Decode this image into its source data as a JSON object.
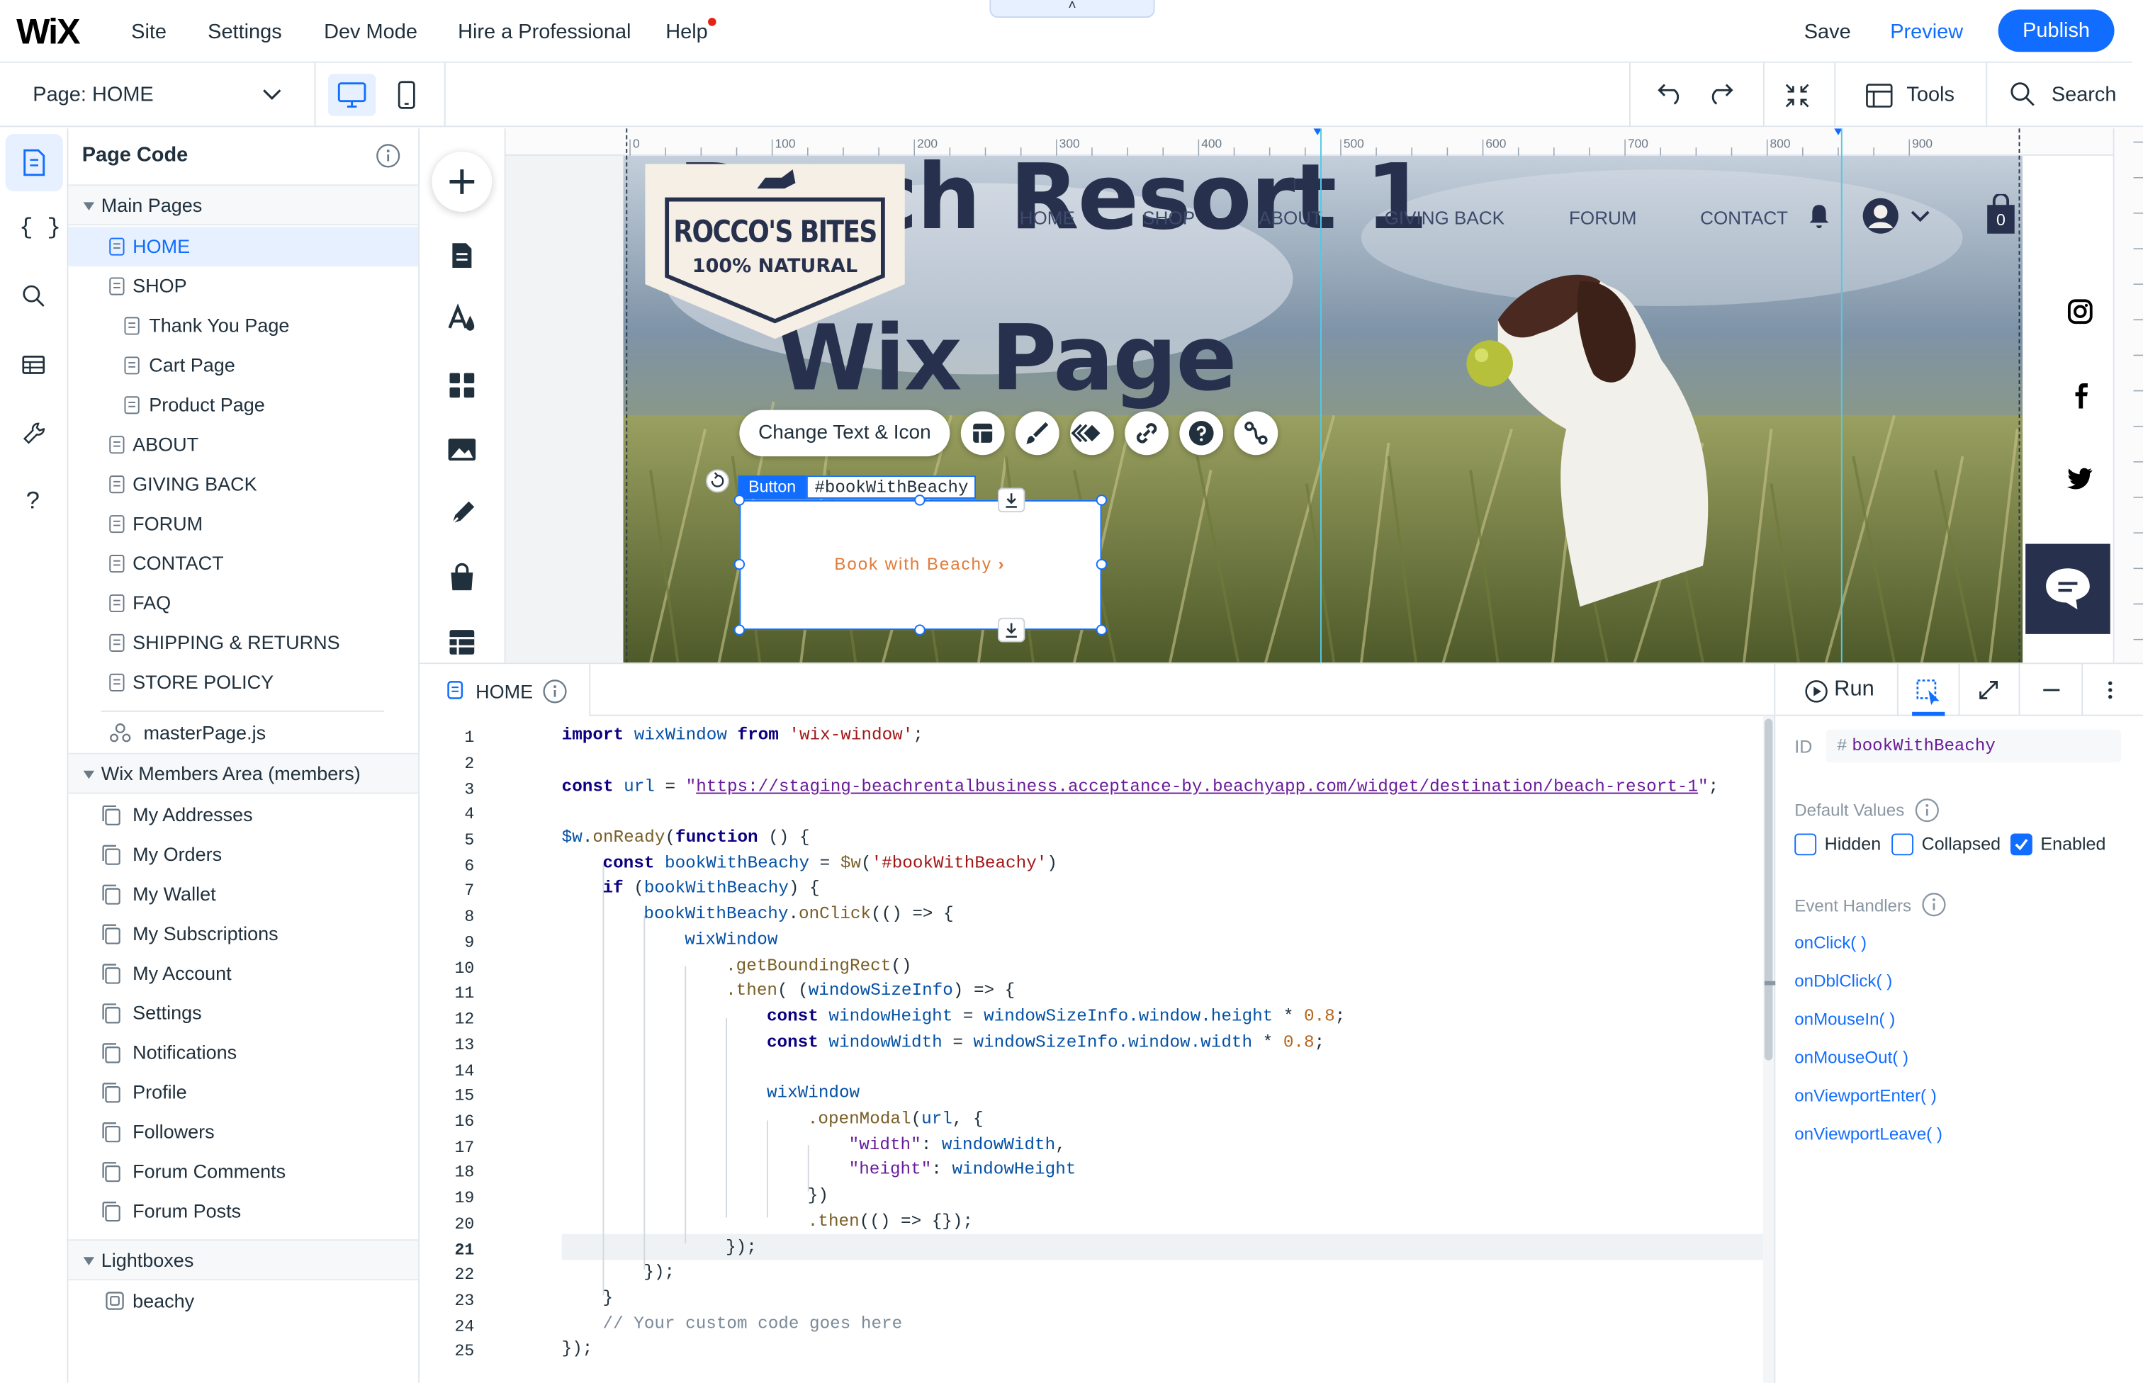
{
  "topbar": {
    "logo": "WiX",
    "menu": [
      "Site",
      "Settings",
      "Dev Mode",
      "Hire a Professional",
      "Help"
    ],
    "save": "Save",
    "preview": "Preview",
    "publish": "Publish",
    "collapse": "˄"
  },
  "toolbar": {
    "page_label": "Page:",
    "page_name": "HOME",
    "tools": "Tools",
    "search": "Search"
  },
  "panel": {
    "title": "Page Code",
    "main_pages_header": "Main Pages",
    "main_pages": [
      "HOME",
      "SHOP",
      "Thank You Page",
      "Cart Page",
      "Product Page",
      "ABOUT",
      "GIVING BACK",
      "FORUM",
      "CONTACT",
      "FAQ",
      "SHIPPING & RETURNS",
      "STORE POLICY"
    ],
    "master_page": "masterPage.js",
    "members_header": "Wix Members Area (members)",
    "members_pages": [
      "My Addresses",
      "My Orders",
      "My Wallet",
      "My Subscriptions",
      "My Account",
      "Settings",
      "Notifications",
      "Profile",
      "Followers",
      "Forum Comments",
      "Forum Posts"
    ],
    "lightboxes_header": "Lightboxes",
    "lightboxes": [
      "beachy"
    ]
  },
  "canvas": {
    "ruler_ticks": [
      "0",
      "100",
      "200",
      "300",
      "400",
      "500",
      "600",
      "700",
      "800",
      "900"
    ],
    "heading_line1": "Beach Resort 1",
    "heading_line2": "Wix Page",
    "logo_line1": "ROCCO'S BITES",
    "logo_line2": "100% NATURAL",
    "nav": [
      "HOME",
      "SHOP",
      "ABOUT",
      "GIVING BACK",
      "FORUM",
      "CONTACT"
    ],
    "cart_count": "0",
    "change_text_icon": "Change Text & Icon",
    "element_type": "Button",
    "element_id": "#bookWithBeachy",
    "button_label": "Book with Beachy"
  },
  "code_editor": {
    "tab": "HOME",
    "run": "Run",
    "current_line": 21,
    "line_numbers": [
      "1",
      "2",
      "3",
      "4",
      "5",
      "6",
      "7",
      "8",
      "9",
      "10",
      "11",
      "12",
      "13",
      "14",
      "15",
      "16",
      "17",
      "18",
      "19",
      "20",
      "21",
      "22",
      "23",
      "24",
      "25"
    ],
    "url": "https://staging-beachrentalbusiness.acceptance-by.beachyapp.com/widget/destination/beach-resort-1",
    "lines": {
      "l1_kw": "import",
      "l1_id": "wixWindow",
      "l1_from": "from",
      "l1_str": "'wix-window'",
      "l1_end": ";",
      "l3_kw": "const",
      "l3_id": "url",
      "l3_eq": " = ",
      "l3_q1": "\"",
      "l3_q2": "\"",
      "l3_end": ";",
      "l5_a": "$w",
      "l5_b": ".",
      "l5_c": "onReady",
      "l5_d": "(",
      "l5_e": "function",
      "l5_f": " () {",
      "l6_kw": "const",
      "l6_id": "bookWithBeachy",
      "l6_eq": " = ",
      "l6_fn": "$w",
      "l6_p": "(",
      "l6_str": "'#bookWithBeachy'",
      "l6_end": ")",
      "l7_kw": "if",
      "l7_a": " (",
      "l7_id": "bookWithBeachy",
      "l7_b": ") {",
      "l8_id": "bookWithBeachy",
      "l8_dot": ".",
      "l8_fn": "onClick",
      "l8_rest": "(() => {",
      "l9_id": "wixWindow",
      "l10_fn": ".getBoundingRect",
      "l10_rest": "()",
      "l11_fn": ".then",
      "l11_a": "( (",
      "l11_id": "windowSizeInfo",
      "l11_b": ") => {",
      "l12_kw": "const",
      "l12_id": "windowHeight",
      "l12_eq": " = ",
      "l12_ref": "windowSizeInfo.window.height",
      "l12_op": " * ",
      "l12_num": "0.8",
      "l12_end": ";",
      "l13_kw": "const",
      "l13_id": "windowWidth",
      "l13_eq": " = ",
      "l13_ref": "windowSizeInfo.window.width",
      "l13_op": " * ",
      "l13_num": "0.8",
      "l13_end": ";",
      "l15_id": "wixWindow",
      "l16_fn": ".openModal",
      "l16_a": "(",
      "l16_id": "url",
      "l16_b": ", {",
      "l17_k": "\"width\"",
      "l17_c": ": ",
      "l17_v": "windowWidth",
      "l17_e": ",",
      "l18_k": "\"height\"",
      "l18_c": ": ",
      "l18_v": "windowHeight",
      "l19": "})",
      "l20_fn": ".then",
      "l20_rest": "(() => {});",
      "l21": "});",
      "l22": "});",
      "l23": "}",
      "l24": "// Your custom code goes here",
      "l25": "});"
    }
  },
  "properties": {
    "id_label": "ID",
    "id_hash": "#",
    "id_value": "bookWithBeachy",
    "default_values": "Default Values",
    "hidden": "Hidden",
    "collapsed": "Collapsed",
    "enabled": "Enabled",
    "enabled_checked": true,
    "event_handlers": "Event Handlers",
    "events": [
      "onClick( )",
      "onDblClick( )",
      "onMouseIn( )",
      "onMouseOut( )",
      "onViewportEnter( )",
      "onViewportLeave( )"
    ]
  },
  "colors": {
    "accent": "#116dff",
    "button_text": "#e07b3a",
    "logo_navy": "#27314e"
  }
}
